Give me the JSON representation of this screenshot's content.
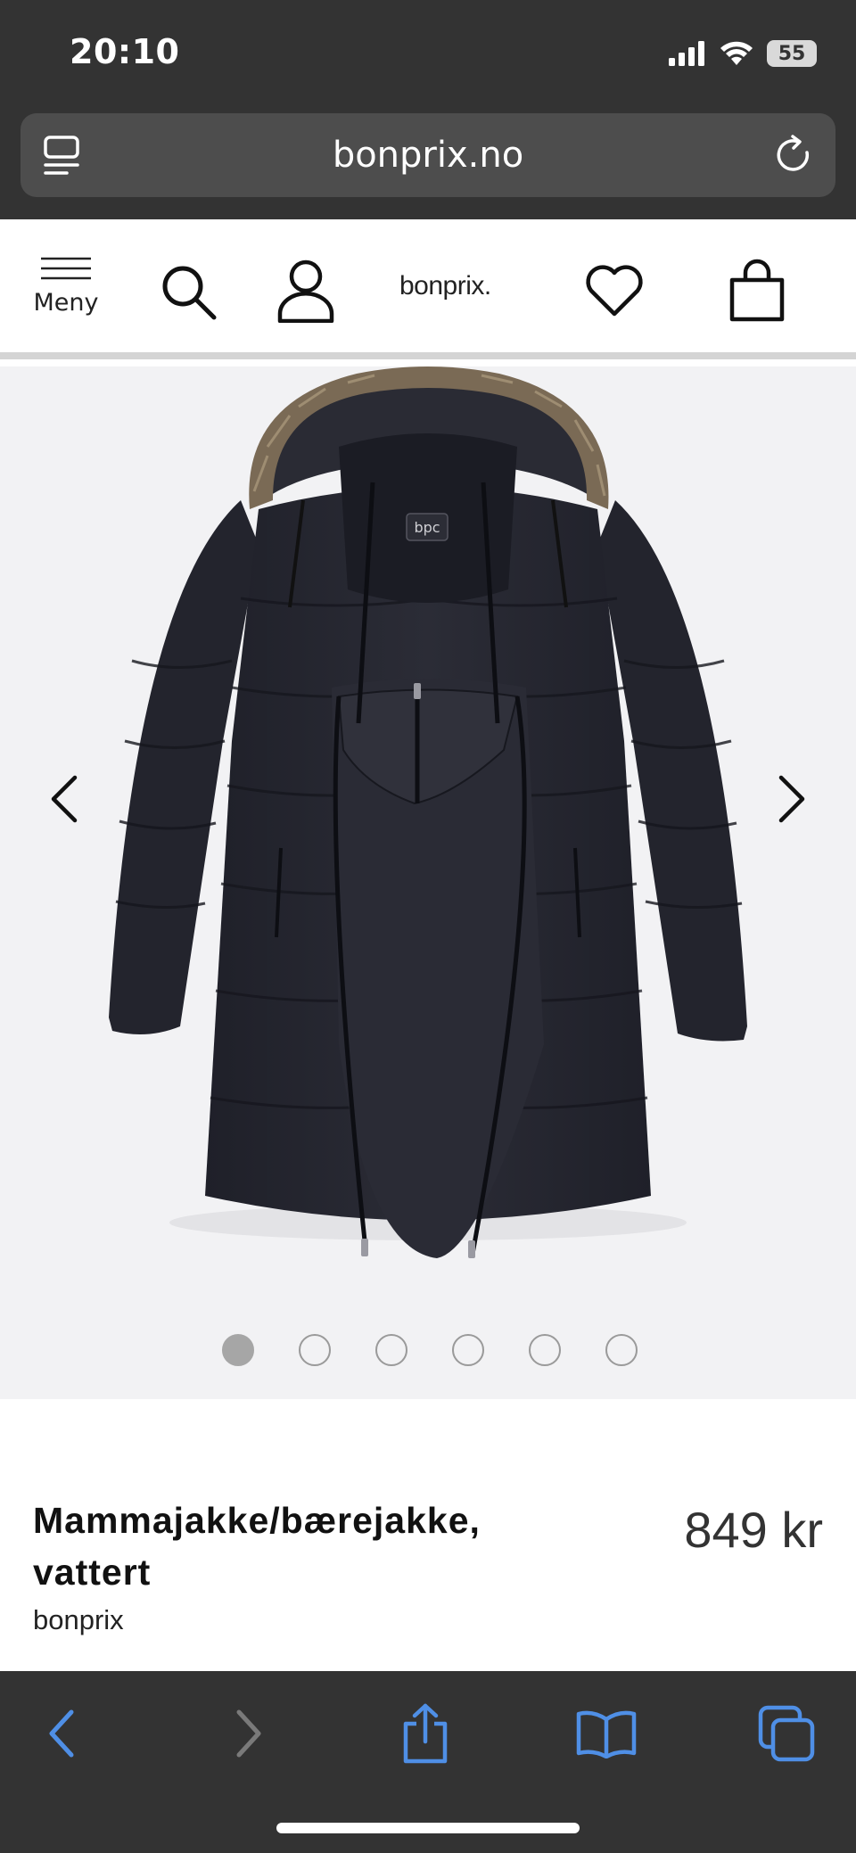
{
  "status_bar": {
    "time": "20:10",
    "battery_level": "55",
    "icons": [
      "signal-icon",
      "wifi-icon",
      "battery-icon"
    ]
  },
  "browser": {
    "url": "bonprix.no",
    "icons": [
      "reader-mode-icon",
      "reload-icon"
    ]
  },
  "site_header": {
    "menu_label": "Meny",
    "logo_text": "bonprix.",
    "icons": [
      "hamburger-menu-icon",
      "search-icon",
      "account-icon",
      "heart-icon",
      "shopping-bag-icon"
    ]
  },
  "gallery": {
    "image_count": 6,
    "active_index": 0,
    "image_description_icon": "jacket-image",
    "logo_on_garment": "bpc"
  },
  "product": {
    "title": "Mammajakke/bærejakke, vattert",
    "brand": "bonprix",
    "price": "849 kr"
  },
  "toolbar": {
    "icons": [
      "back-icon",
      "forward-icon",
      "share-icon",
      "bookmarks-icon",
      "tabs-icon"
    ]
  },
  "colors": {
    "browser_chrome": "#333333",
    "url_field": "#4d4d4d",
    "toolbar_accent": "#4f8fe6",
    "toolbar_disabled": "#7a7a7a",
    "gallery_bg": "#f2f2f4",
    "jacket": "#262730",
    "fur": "#7a6a55"
  }
}
